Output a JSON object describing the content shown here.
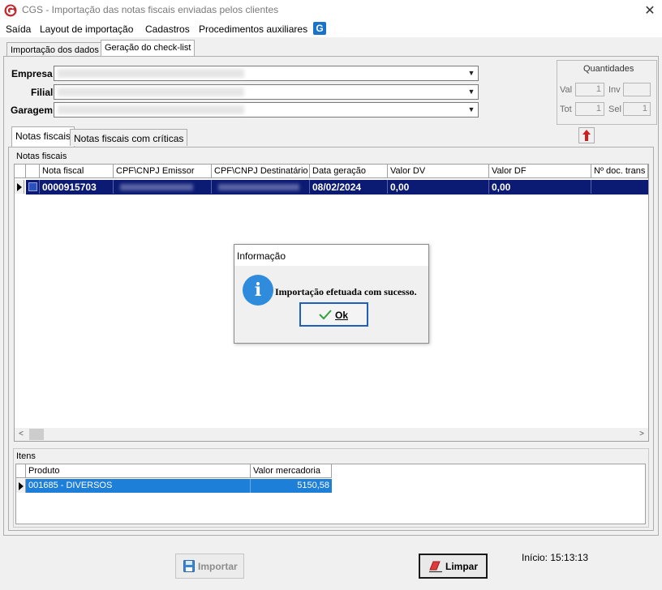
{
  "window": {
    "title": "CGS - Importação das notas fiscais enviadas pelos clientes",
    "close_glyph": "✕",
    "app_icon": "cgs-logo-icon"
  },
  "menu": {
    "items": [
      "Saída",
      "Layout de importação",
      "Cadastros",
      "Procedimentos auxiliares"
    ],
    "logo_letter": "G"
  },
  "top_tabs": {
    "items": [
      "Importação dos dados",
      "Geração do check-list"
    ],
    "active": 1
  },
  "header": {
    "empresa_label": "Empresa",
    "filial_label": "Filial",
    "garagem_label": "Garagem"
  },
  "quantidades": {
    "title": "Quantidades",
    "val_label": "Val",
    "val_value": "1",
    "inv_label": "Inv",
    "inv_value": "",
    "tot_label": "Tot",
    "tot_value": "1",
    "sel_label": "Sel",
    "sel_value": "1"
  },
  "inner_tabs": {
    "items": [
      "Notas fiscais",
      "Notas fiscais com críticas"
    ],
    "active": 0
  },
  "notas": {
    "group_title": "Notas fiscais",
    "columns": [
      "Nota fiscal",
      "CPF\\CNPJ Emissor",
      "CPF\\CNPJ Destinatário",
      "Data geração",
      "Valor DV",
      "Valor DF",
      "Nº doc. trans"
    ],
    "rows": [
      {
        "nota": "0000915703",
        "emissor": "",
        "destinatario": "",
        "data": "08/02/2024",
        "valor_dv": "0,00",
        "valor_df": "0,00",
        "doc": ""
      }
    ]
  },
  "itens": {
    "group_title": "Itens",
    "columns": [
      "Produto",
      "Valor mercadoria"
    ],
    "rows": [
      {
        "produto": "001685 - DIVERSOS",
        "valor": "5150,58"
      }
    ]
  },
  "dialog": {
    "title": "Informação",
    "icon_letter": "i",
    "message": "Importação efetuada com sucesso.",
    "ok_label": "Ok"
  },
  "footer": {
    "importar_label": "Importar",
    "limpar_label": "Limpar",
    "inicio_text": "Início: 15:13:13"
  },
  "colors": {
    "selection": "#0b1a72",
    "item_selection": "#1e7fd8",
    "info_blue": "#2f8cdc"
  }
}
